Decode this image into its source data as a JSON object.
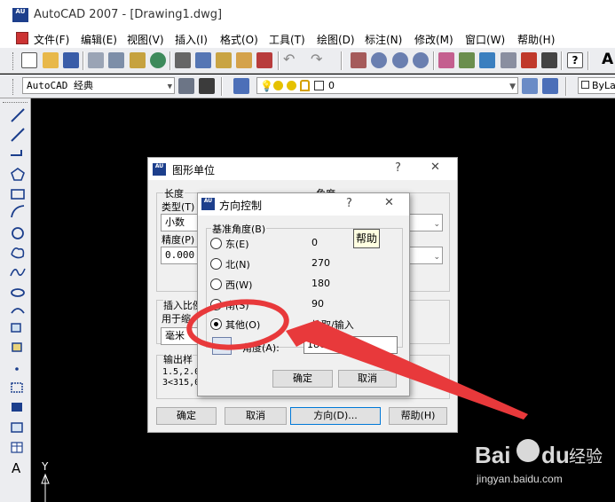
{
  "window": {
    "title": "AutoCAD 2007 - [Drawing1.dwg]",
    "app_icon_text": "AU"
  },
  "menu": {
    "items": [
      "文件(F)",
      "编辑(E)",
      "视图(V)",
      "插入(I)",
      "格式(O)",
      "工具(T)",
      "绘图(D)",
      "标注(N)",
      "修改(M)",
      "窗口(W)",
      "帮助(H)"
    ]
  },
  "toolbar": {
    "workspace": "AutoCAD 经典",
    "layer_value": "0",
    "bylayer": "ByLay",
    "edge_letter": "A"
  },
  "units_dialog": {
    "title": "图形单位",
    "help_symbol": "?",
    "close_symbol": "✕",
    "length_label": "长度",
    "length_type_label": "类型(T)",
    "length_type_value": "小数",
    "precision_label": "精度(P)",
    "precision_value": "0.000",
    "angle_label": "角度",
    "insert_scale_label": "插入比例",
    "insert_scale_sub_label": "用于缩",
    "insert_scale_value": "毫米",
    "output_sample_label": "输出样",
    "sample_line1": "1.5,2.0",
    "sample_line2": "3<315,0",
    "ok_button": "确定",
    "cancel_button": "取消",
    "direction_button": "方向(D)...",
    "help_button": "帮助(H)"
  },
  "direction_dialog": {
    "title": "方向控制",
    "help_symbol": "?",
    "close_symbol": "✕",
    "base_angle_label": "基准角度(B)",
    "options": [
      {
        "label": "东(E)",
        "value": "0",
        "selected": false
      },
      {
        "label": "北(N)",
        "value": "270",
        "selected": false
      },
      {
        "label": "西(W)",
        "value": "180",
        "selected": false
      },
      {
        "label": "南(S)",
        "value": "90",
        "selected": false
      },
      {
        "label": "其他(O)",
        "value": "拾取/输入",
        "selected": true
      }
    ],
    "angle_label": "角度(A):",
    "angle_value": "180",
    "ok_button": "确定",
    "cancel_button": "取消"
  },
  "tooltip": {
    "text": "帮助"
  },
  "ucs": {
    "y_label": "Y"
  },
  "watermark": {
    "brand": "Bai",
    "brand2": "du",
    "product": "经验",
    "url": "jingyan.baidu.com"
  },
  "colors": {
    "annotation": "#e8393b",
    "canvas": "#000000",
    "accent": "#0078d7"
  }
}
